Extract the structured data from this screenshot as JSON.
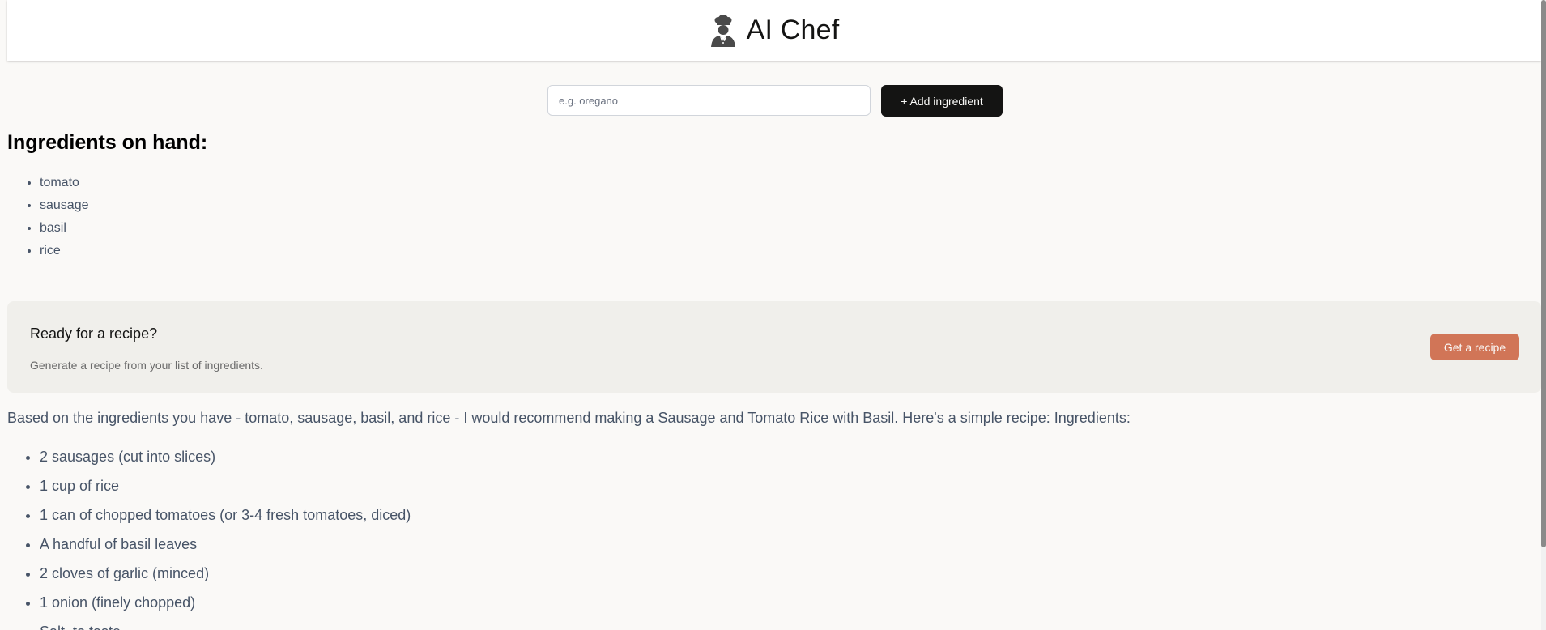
{
  "header": {
    "title": "AI Chef",
    "icon": "chef-icon"
  },
  "add_form": {
    "placeholder": "e.g. oregano",
    "value": "",
    "button_label": "+ Add ingredient"
  },
  "ingredients": {
    "heading": "Ingredients on hand:",
    "items": [
      "tomato",
      "sausage",
      "basil",
      "rice"
    ]
  },
  "recipe_cta": {
    "title": "Ready for a recipe?",
    "subtitle": "Generate a recipe from your list of ingredients.",
    "button_label": "Get a recipe"
  },
  "recipe": {
    "intro": "Based on the ingredients you have - tomato, sausage, basil, and rice - I would recommend making a Sausage and Tomato Rice with Basil. Here's a simple recipe: Ingredients:",
    "ingredients": [
      "2 sausages (cut into slices)",
      "1 cup of rice",
      "1 can of chopped tomatoes (or 3-4 fresh tomatoes, diced)",
      "A handful of basil leaves",
      "2 cloves of garlic (minced)",
      "1 onion (finely chopped)",
      "Salt, to taste"
    ]
  },
  "colors": {
    "background": "#faf9f7",
    "primary_button": "#141413",
    "accent_button": "#d17557",
    "cta_background": "#f0efeb",
    "list_text": "#475467"
  }
}
